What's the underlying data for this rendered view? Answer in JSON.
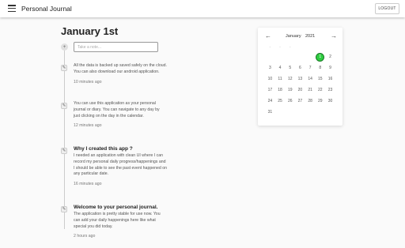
{
  "appbar": {
    "title": "Personal Journal",
    "logout_label": "LOGOUT"
  },
  "heading": "January 1st",
  "note_input": {
    "placeholder": "Take a note...",
    "value": ""
  },
  "entries": [
    {
      "title": "",
      "body": "All the data is backed up saved safely on the cloud. You can also download our android application.",
      "time": "10 minutes ago"
    },
    {
      "title": "",
      "body": "You can use this application as your personal journal or diary. You can navigate to any day by just clicking on the day in the calendar.",
      "time": "12 minutes ago"
    },
    {
      "title": "Why I created this app ?",
      "body": "I needed an application with clean UI where I can record my personal daily progress/happenings and I should be able to see the past event happened on any particular date.",
      "time": "16 minutes ago"
    },
    {
      "title": "Welcome to your personal journal.",
      "body": "The application is pretty stable for use now. You can add your daily happenings here like what special you did today.",
      "time": "2 hours ago"
    }
  ],
  "calendar": {
    "prev_icon": "chevron-left",
    "next_icon": "chevron-right",
    "month": "January",
    "year": "2021",
    "weekdays": [
      "-",
      "-",
      "-",
      "",
      "",
      "",
      ""
    ],
    "days": [
      [
        "",
        "",
        "",
        "",
        "",
        "1",
        "2"
      ],
      [
        "3",
        "4",
        "5",
        "6",
        "7",
        "8",
        "9"
      ],
      [
        "10",
        "11",
        "12",
        "13",
        "14",
        "15",
        "16"
      ],
      [
        "17",
        "18",
        "19",
        "20",
        "21",
        "22",
        "23"
      ],
      [
        "24",
        "25",
        "26",
        "27",
        "28",
        "29",
        "30"
      ],
      [
        "31",
        "",
        "",
        "",
        "",
        "",
        ""
      ]
    ],
    "selected": "1",
    "accent_color": "#2ecc40"
  }
}
